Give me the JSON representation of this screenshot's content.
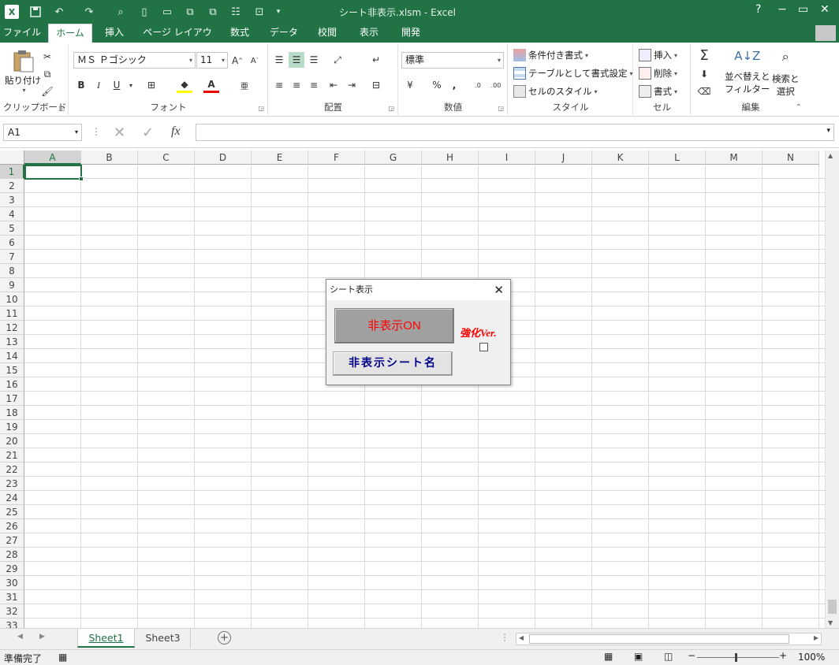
{
  "titlebar": {
    "title": "シート非表示.xlsm - Excel",
    "help": "?",
    "minimize": "−",
    "restore": "▭",
    "close": "✕"
  },
  "tabs": [
    "ファイル",
    "ホーム",
    "挿入",
    "ページ レイアウト",
    "数式",
    "データ",
    "校閲",
    "表示",
    "開発"
  ],
  "ribbon": {
    "clipboard": {
      "paste": "貼り付け",
      "label": "クリップボード"
    },
    "font": {
      "name": "ＭＳ Ｐゴシック",
      "size": "11",
      "bold": "B",
      "italic": "I",
      "underline": "U",
      "label": "フォント"
    },
    "alignment": {
      "label": "配置"
    },
    "number": {
      "format": "標準",
      "percent": "%",
      "comma": ",",
      "label": "数値"
    },
    "styles": {
      "conditional": "条件付き書式",
      "table": "テーブルとして書式設定",
      "cell": "セルのスタイル",
      "label": "スタイル"
    },
    "cells": {
      "insert": "挿入",
      "delete": "削除",
      "format": "書式",
      "label": "セル"
    },
    "editing": {
      "sort": "並べ替えと",
      "sort2": "フィルター",
      "find": "検索と",
      "find2": "選択",
      "label": "編集"
    }
  },
  "formulabar": {
    "namebox": "A1",
    "fx": "fx",
    "value": ""
  },
  "grid": {
    "columns": [
      "A",
      "B",
      "C",
      "D",
      "E",
      "F",
      "G",
      "H",
      "I",
      "J",
      "K",
      "L",
      "M",
      "N"
    ],
    "rows": [
      "1",
      "2",
      "3",
      "4",
      "5",
      "6",
      "7",
      "8",
      "9",
      "10",
      "11",
      "12",
      "13",
      "14",
      "15",
      "16",
      "17",
      "18",
      "19",
      "20",
      "21",
      "22",
      "23",
      "24",
      "25",
      "26",
      "27",
      "28",
      "29",
      "30",
      "31",
      "32",
      "33"
    ],
    "active_cell": "A1"
  },
  "sheets": [
    {
      "name": "Sheet1",
      "active": true
    },
    {
      "name": "Sheet3",
      "active": false
    }
  ],
  "status": {
    "ready": "準備完了",
    "zoom": "100%"
  },
  "dialog": {
    "title": "シート表示",
    "close": "✕",
    "hide_button": "非表示ON",
    "names_button": "非表示シート名",
    "enhanced_label": "強化Ver.",
    "enhanced_checked": false
  },
  "colors": {
    "excel_green": "#217346",
    "hide_text": "#ff0000",
    "names_text": "#00008b"
  }
}
